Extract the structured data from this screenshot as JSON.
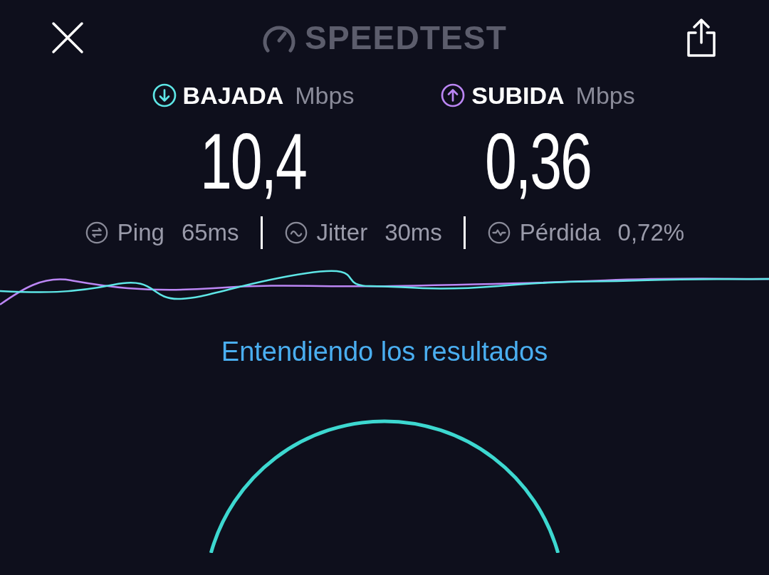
{
  "top_bar": {
    "logo": "SPEEDTEST"
  },
  "results": [
    {
      "kind": "download",
      "label": "BAJADA",
      "unit": "Mbps",
      "value": "10,4",
      "color": "#5ee6e6"
    },
    {
      "kind": "upload",
      "label": "SUBIDA",
      "unit": "Mbps",
      "value": "0,36",
      "color": "#bb86f4"
    }
  ],
  "metrics": [
    {
      "kind": "ping",
      "label": "Ping",
      "value": "65",
      "unit": "ms"
    },
    {
      "kind": "jitter",
      "label": "Jitter",
      "value": "30",
      "unit": "ms"
    },
    {
      "kind": "loss",
      "label": "Pérdida",
      "value": "0,72",
      "unit": "%"
    }
  ],
  "link": "Entendiendo los resultados"
}
